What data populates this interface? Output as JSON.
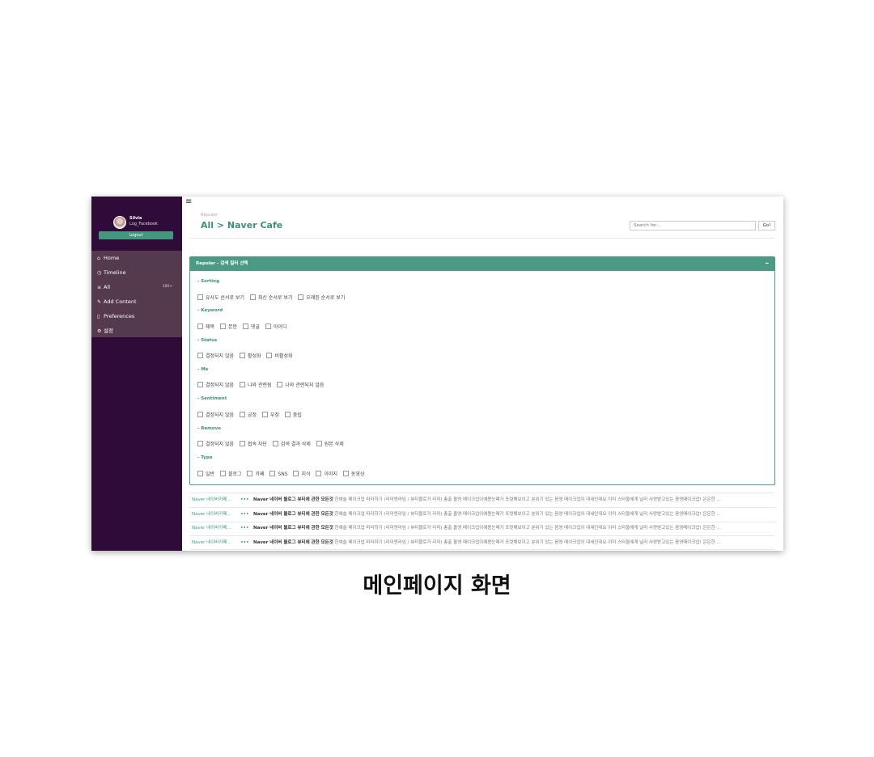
{
  "sidebar": {
    "user_name": "Silvia",
    "user_account": "Log_Facebook",
    "logout_label": "Logout",
    "nav": [
      {
        "label": "Home",
        "icon": "home-icon",
        "glyph": "⌂"
      },
      {
        "label": "Timeline",
        "icon": "clock-icon",
        "glyph": "◷"
      },
      {
        "label": "All",
        "icon": "list-icon",
        "glyph": "≡",
        "badge": "100+"
      },
      {
        "label": "Add Content",
        "icon": "tag-icon",
        "glyph": "✎"
      },
      {
        "label": "Preferences",
        "icon": "phone-icon",
        "glyph": "▯"
      },
      {
        "label": "설정",
        "icon": "gear-icon",
        "glyph": "⚙"
      }
    ]
  },
  "header": {
    "hamburger_glyph": "≡",
    "crumb_small": "Repuler",
    "title": "All > Naver Cafe",
    "search_placeholder": "Search for...",
    "go_label": "Go!"
  },
  "filter_panel": {
    "title": "Repuler - 검색 필터 선택",
    "collapse_glyph": "–",
    "sections": [
      {
        "title": "- Sorting",
        "options": [
          "유사도 순서로 보기",
          "최신 순서로 보기",
          "오래된 순서로 보기"
        ]
      },
      {
        "title": "- Keyword",
        "options": [
          "제목",
          "본문",
          "댓글",
          "아이디"
        ]
      },
      {
        "title": "- Status",
        "options": [
          "결정되지 않음",
          "활성화",
          "비활성화"
        ]
      },
      {
        "title": "- Me",
        "options": [
          "결정되지 않음",
          "나와 관련됨",
          "나와 관련되지 않음"
        ]
      },
      {
        "title": "- Sentiment",
        "options": [
          "결정되지 않음",
          "긍정",
          "부정",
          "중립"
        ]
      },
      {
        "title": "- Remove",
        "options": [
          "결정되지 않음",
          "접속 차단",
          "검색 결과 삭제",
          "원본 삭제"
        ]
      },
      {
        "title": "- Type",
        "options": [
          "일반",
          "블로그",
          "카페",
          "SNS",
          "지식",
          "이미지",
          "동영상"
        ]
      }
    ]
  },
  "results": [
    {
      "source": "Naver 네이버카페...",
      "dots": "•••",
      "title": "Naver 네이버 블로그 뷰티에 관한 모든것",
      "snippet": "한예슬 메이크업 따라하기 (리미엔라임 / 뷰티블로거 리미) 총출 올영 메이크업이예용눈매가 또렷해보이고 분위기 있는 음영 메이크업이 대세인데요 이미 스타들에게 널리 사랑받고있는 음영메이크업! 은은한 ..."
    },
    {
      "source": "Naver 네이버카페...",
      "dots": "•••",
      "title": "Naver 네이버 블로그 뷰티에 관한 모든것",
      "snippet": "한예슬 메이크업 따라하기 (리미엔라임 / 뷰티블로거 리미) 총출 올영 메이크업이예용눈매가 또렷해보이고 분위기 있는 음영 메이크업이 대세인데요 이미 스타들에게 널리 사랑받고있는 음영메이크업! 은은한 ..."
    },
    {
      "source": "Naver 네이버카페...",
      "dots": "•••",
      "title": "Naver 네이버 블로그 뷰티에 관한 모든것",
      "snippet": "한예슬 메이크업 따라하기 (리미엔라임 / 뷰티블로거 리미) 총출 올영 메이크업이예용눈매가 또렷해보이고 분위기 있는 음영 메이크업이 대세인데요 이미 스타들에게 널리 사랑받고있는 음영메이크업! 은은한 ..."
    },
    {
      "source": "Naver 네이버카페...",
      "dots": "•••",
      "title": "Naver 네이버 블로그 뷰티에 관한 모든것",
      "snippet": "한예슬 메이크업 따라하기 (리미엔라임 / 뷰티블로거 리미) 총출 올영 메이크업이예용눈매가 또렷해보이고 분위기 있는 음영 메이크업이 대세인데요 이미 스타들에게 널리 사랑받고있는 음영메이크업! 은은한 ..."
    }
  ],
  "caption": "메인페이지 화면",
  "colors": {
    "sidebar": "#2f0b3a",
    "nav": "#55394d",
    "accent": "#4a9a86",
    "link": "#3f9a7a"
  }
}
